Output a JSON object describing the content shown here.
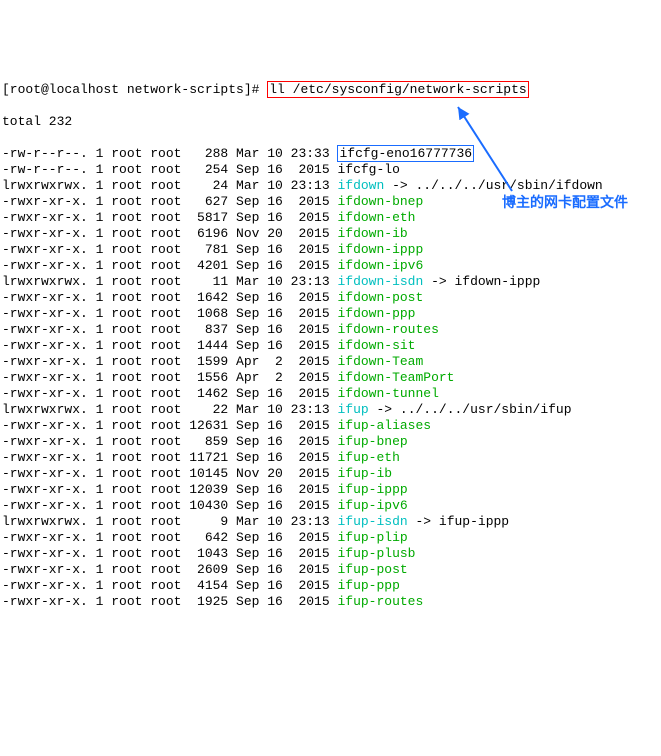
{
  "prompt": "[root@localhost network-scripts]# ",
  "command": "ll /etc/sysconfig/network-scripts",
  "total": "total 232",
  "annotation": "博主的网卡配置文件",
  "highlight_file": "ifcfg-eno16777736",
  "rows": [
    {
      "perm": "-rw-r--r--.",
      "links": "1",
      "owner": "root",
      "group": "root",
      "size": "288",
      "date": "Mar 10",
      "time": "23:33",
      "name": "ifcfg-eno16777736",
      "cls": "black",
      "boxed": true
    },
    {
      "perm": "-rw-r--r--.",
      "links": "1",
      "owner": "root",
      "group": "root",
      "size": "254",
      "date": "Sep 16",
      "time": "2015",
      "name": "ifcfg-lo",
      "cls": "black"
    },
    {
      "perm": "lrwxrwxrwx.",
      "links": "1",
      "owner": "root",
      "group": "root",
      "size": "24",
      "date": "Mar 10",
      "time": "23:13",
      "name": "ifdown",
      "cls": "cyan",
      "link": " -> ../../../usr/sbin/ifdown"
    },
    {
      "perm": "-rwxr-xr-x.",
      "links": "1",
      "owner": "root",
      "group": "root",
      "size": "627",
      "date": "Sep 16",
      "time": "2015",
      "name": "ifdown-bnep",
      "cls": "green"
    },
    {
      "perm": "-rwxr-xr-x.",
      "links": "1",
      "owner": "root",
      "group": "root",
      "size": "5817",
      "date": "Sep 16",
      "time": "2015",
      "name": "ifdown-eth",
      "cls": "green"
    },
    {
      "perm": "-rwxr-xr-x.",
      "links": "1",
      "owner": "root",
      "group": "root",
      "size": "6196",
      "date": "Nov 20",
      "time": "2015",
      "name": "ifdown-ib",
      "cls": "green"
    },
    {
      "perm": "-rwxr-xr-x.",
      "links": "1",
      "owner": "root",
      "group": "root",
      "size": "781",
      "date": "Sep 16",
      "time": "2015",
      "name": "ifdown-ippp",
      "cls": "green"
    },
    {
      "perm": "-rwxr-xr-x.",
      "links": "1",
      "owner": "root",
      "group": "root",
      "size": "4201",
      "date": "Sep 16",
      "time": "2015",
      "name": "ifdown-ipv6",
      "cls": "green"
    },
    {
      "perm": "lrwxrwxrwx.",
      "links": "1",
      "owner": "root",
      "group": "root",
      "size": "11",
      "date": "Mar 10",
      "time": "23:13",
      "name": "ifdown-isdn",
      "cls": "cyan",
      "link": " -> ifdown-ippp"
    },
    {
      "perm": "-rwxr-xr-x.",
      "links": "1",
      "owner": "root",
      "group": "root",
      "size": "1642",
      "date": "Sep 16",
      "time": "2015",
      "name": "ifdown-post",
      "cls": "green"
    },
    {
      "perm": "-rwxr-xr-x.",
      "links": "1",
      "owner": "root",
      "group": "root",
      "size": "1068",
      "date": "Sep 16",
      "time": "2015",
      "name": "ifdown-ppp",
      "cls": "green"
    },
    {
      "perm": "-rwxr-xr-x.",
      "links": "1",
      "owner": "root",
      "group": "root",
      "size": "837",
      "date": "Sep 16",
      "time": "2015",
      "name": "ifdown-routes",
      "cls": "green"
    },
    {
      "perm": "-rwxr-xr-x.",
      "links": "1",
      "owner": "root",
      "group": "root",
      "size": "1444",
      "date": "Sep 16",
      "time": "2015",
      "name": "ifdown-sit",
      "cls": "green"
    },
    {
      "perm": "-rwxr-xr-x.",
      "links": "1",
      "owner": "root",
      "group": "root",
      "size": "1599",
      "date": "Apr  2",
      "time": "2015",
      "name": "ifdown-Team",
      "cls": "green"
    },
    {
      "perm": "-rwxr-xr-x.",
      "links": "1",
      "owner": "root",
      "group": "root",
      "size": "1556",
      "date": "Apr  2",
      "time": "2015",
      "name": "ifdown-TeamPort",
      "cls": "green"
    },
    {
      "perm": "-rwxr-xr-x.",
      "links": "1",
      "owner": "root",
      "group": "root",
      "size": "1462",
      "date": "Sep 16",
      "time": "2015",
      "name": "ifdown-tunnel",
      "cls": "green"
    },
    {
      "perm": "lrwxrwxrwx.",
      "links": "1",
      "owner": "root",
      "group": "root",
      "size": "22",
      "date": "Mar 10",
      "time": "23:13",
      "name": "ifup",
      "cls": "cyan",
      "link": " -> ../../../usr/sbin/ifup"
    },
    {
      "perm": "-rwxr-xr-x.",
      "links": "1",
      "owner": "root",
      "group": "root",
      "size": "12631",
      "date": "Sep 16",
      "time": "2015",
      "name": "ifup-aliases",
      "cls": "green"
    },
    {
      "perm": "-rwxr-xr-x.",
      "links": "1",
      "owner": "root",
      "group": "root",
      "size": "859",
      "date": "Sep 16",
      "time": "2015",
      "name": "ifup-bnep",
      "cls": "green"
    },
    {
      "perm": "-rwxr-xr-x.",
      "links": "1",
      "owner": "root",
      "group": "root",
      "size": "11721",
      "date": "Sep 16",
      "time": "2015",
      "name": "ifup-eth",
      "cls": "green"
    },
    {
      "perm": "-rwxr-xr-x.",
      "links": "1",
      "owner": "root",
      "group": "root",
      "size": "10145",
      "date": "Nov 20",
      "time": "2015",
      "name": "ifup-ib",
      "cls": "green"
    },
    {
      "perm": "-rwxr-xr-x.",
      "links": "1",
      "owner": "root",
      "group": "root",
      "size": "12039",
      "date": "Sep 16",
      "time": "2015",
      "name": "ifup-ippp",
      "cls": "green"
    },
    {
      "perm": "-rwxr-xr-x.",
      "links": "1",
      "owner": "root",
      "group": "root",
      "size": "10430",
      "date": "Sep 16",
      "time": "2015",
      "name": "ifup-ipv6",
      "cls": "green"
    },
    {
      "perm": "lrwxrwxrwx.",
      "links": "1",
      "owner": "root",
      "group": "root",
      "size": "9",
      "date": "Mar 10",
      "time": "23:13",
      "name": "ifup-isdn",
      "cls": "cyan",
      "link": " -> ifup-ippp"
    },
    {
      "perm": "-rwxr-xr-x.",
      "links": "1",
      "owner": "root",
      "group": "root",
      "size": "642",
      "date": "Sep 16",
      "time": "2015",
      "name": "ifup-plip",
      "cls": "green"
    },
    {
      "perm": "-rwxr-xr-x.",
      "links": "1",
      "owner": "root",
      "group": "root",
      "size": "1043",
      "date": "Sep 16",
      "time": "2015",
      "name": "ifup-plusb",
      "cls": "green"
    },
    {
      "perm": "-rwxr-xr-x.",
      "links": "1",
      "owner": "root",
      "group": "root",
      "size": "2609",
      "date": "Sep 16",
      "time": "2015",
      "name": "ifup-post",
      "cls": "green"
    },
    {
      "perm": "-rwxr-xr-x.",
      "links": "1",
      "owner": "root",
      "group": "root",
      "size": "4154",
      "date": "Sep 16",
      "time": "2015",
      "name": "ifup-ppp",
      "cls": "green"
    },
    {
      "perm": "-rwxr-xr-x.",
      "links": "1",
      "owner": "root",
      "group": "root",
      "size": "1925",
      "date": "Sep 16",
      "time": "2015",
      "name": "ifup-routes",
      "cls": "green"
    }
  ]
}
